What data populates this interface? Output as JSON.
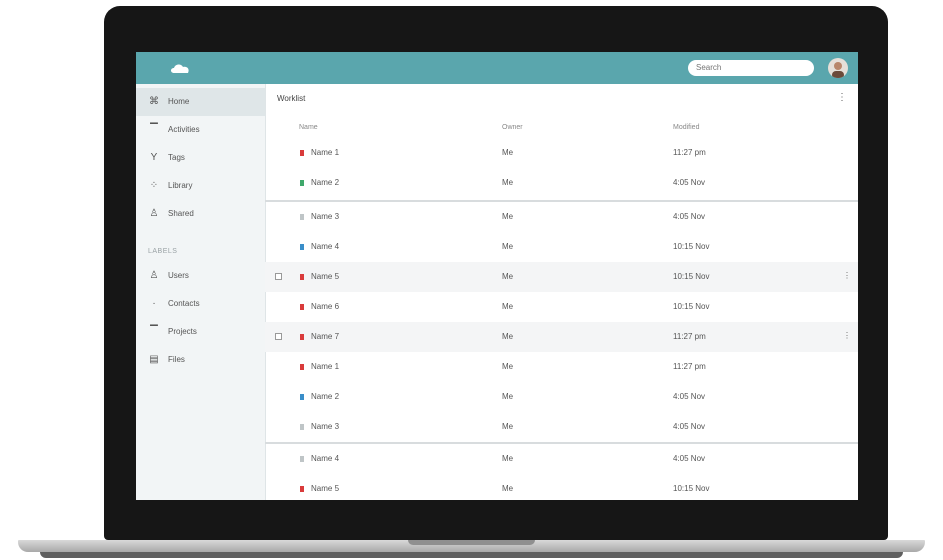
{
  "search": {
    "placeholder": "Search"
  },
  "sidebar": {
    "items": [
      {
        "icon": "grid-icon",
        "label": "Home"
      },
      {
        "icon": "minus-icon",
        "label": "Activities"
      },
      {
        "icon": "filter-icon",
        "label": "Tags"
      },
      {
        "icon": "apps-icon",
        "label": "Library"
      },
      {
        "icon": "person-icon",
        "label": "Shared"
      }
    ],
    "section_label": "LABELS",
    "section_items": [
      {
        "icon": "person-icon",
        "label": "Users"
      },
      {
        "icon": "dot-icon",
        "label": "Contacts"
      },
      {
        "icon": "minus-icon",
        "label": "Projects"
      },
      {
        "icon": "file-icon",
        "label": "Files"
      }
    ]
  },
  "list": {
    "title": "Worklist",
    "columns": [
      "Name",
      "Owner",
      "Modified"
    ],
    "rows": [
      {
        "name": "Name 1",
        "owner": "Me",
        "modified": "11:27 pm"
      },
      {
        "name": "Name 2",
        "owner": "Me",
        "modified": "4:05 Nov"
      },
      {
        "name": "Name 3",
        "owner": "Me",
        "modified": "4:05 Nov"
      },
      {
        "name": "Name 4",
        "owner": "Me",
        "modified": "10:15 Nov"
      },
      {
        "name": "Name 5",
        "owner": "Me",
        "modified": "10:15 Nov"
      },
      {
        "name": "Name 6",
        "owner": "Me",
        "modified": "10:15 Nov"
      },
      {
        "name": "Name 7",
        "owner": "Me",
        "modified": "11:27 pm"
      },
      {
        "name": "Name 1",
        "owner": "Me",
        "modified": "11:27 pm"
      },
      {
        "name": "Name 2",
        "owner": "Me",
        "modified": "4:05 Nov"
      },
      {
        "name": "Name 3",
        "owner": "Me",
        "modified": "4:05 Nov"
      },
      {
        "name": "Name 4",
        "owner": "Me",
        "modified": "4:05 Nov"
      },
      {
        "name": "Name 5",
        "owner": "Me",
        "modified": "10:15 Nov"
      }
    ]
  },
  "colors": {
    "appbar": "#5aa6ad",
    "sidebar": "#f2f5f6",
    "accent_red": "#d93b3b",
    "accent_blue": "#3a8ec9",
    "accent_green": "#3fa86b"
  }
}
